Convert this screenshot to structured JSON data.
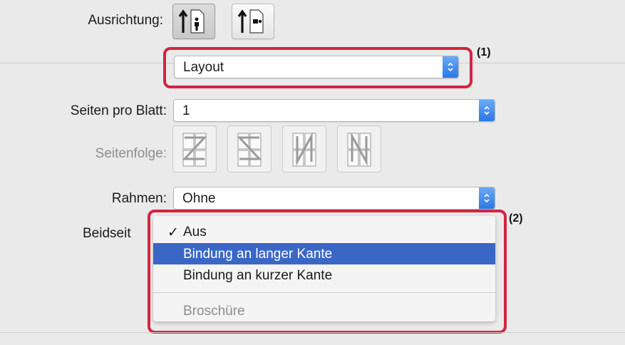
{
  "orientation": {
    "label": "Ausrichtung:",
    "options": [
      "portrait",
      "landscape"
    ],
    "selected": "portrait"
  },
  "panel_select": {
    "value": "Layout",
    "callout": "(1)"
  },
  "pages_per_sheet": {
    "label": "Seiten pro Blatt:",
    "value": "1"
  },
  "page_order": {
    "label": "Seitenfolge:",
    "options": [
      "Z",
      "S",
      "N-reverse",
      "N"
    ]
  },
  "border": {
    "label": "Rahmen:",
    "value": "Ohne"
  },
  "duplex": {
    "label": "Beidseit",
    "callout": "(2)",
    "menu": {
      "check_mark": "✓",
      "items": [
        {
          "label": "Aus",
          "checked": true,
          "highlighted": false,
          "enabled": true
        },
        {
          "label": "Bindung an langer Kante",
          "checked": false,
          "highlighted": true,
          "enabled": true
        },
        {
          "label": "Bindung an kurzer Kante",
          "checked": false,
          "highlighted": false,
          "enabled": true
        },
        {
          "label": "Broschüre",
          "checked": false,
          "highlighted": false,
          "enabled": false
        }
      ]
    }
  },
  "colors": {
    "highlight_red": "#d2253f",
    "menu_selection": "#3a67c6",
    "stepper_blue": "#2d77e6"
  }
}
